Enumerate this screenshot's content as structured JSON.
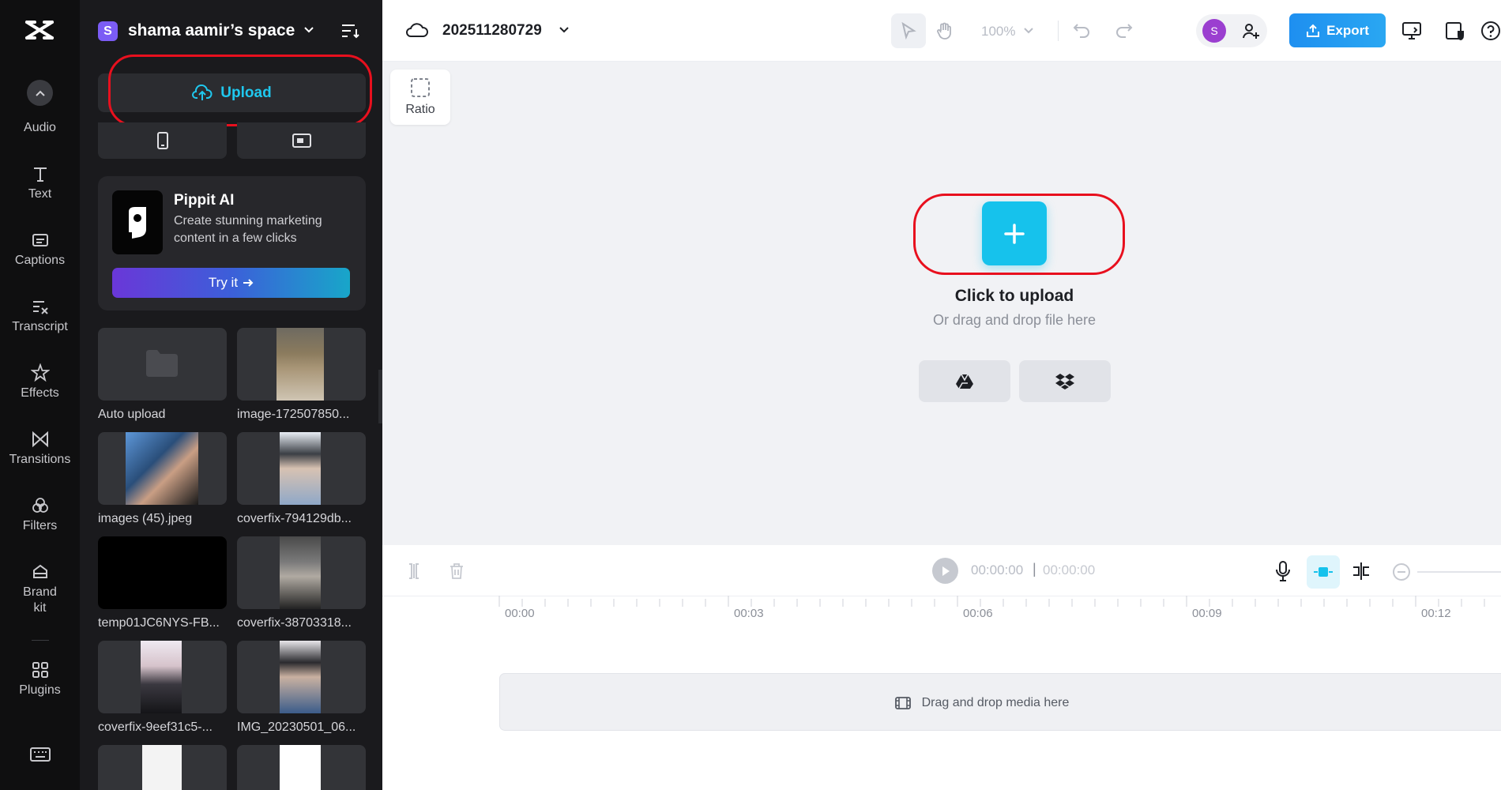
{
  "workspace": {
    "badge": "S",
    "name": "shama aamir’s space"
  },
  "rail": {
    "items": [
      {
        "label": "Audio"
      },
      {
        "label": "Text"
      },
      {
        "label": "Captions"
      },
      {
        "label": "Transcript"
      },
      {
        "label": "Effects"
      },
      {
        "label": "Transitions"
      },
      {
        "label": "Filters"
      },
      {
        "label": "Brand\nkit"
      },
      {
        "label": "Plugins"
      }
    ]
  },
  "panel": {
    "upload_label": "Upload",
    "promo": {
      "title": "Pippit AI",
      "description": "Create stunning marketing content in a few clicks",
      "cta": "Try it"
    },
    "media": [
      {
        "name": "Auto upload"
      },
      {
        "name": "image-172507850..."
      },
      {
        "name": "images (45).jpeg"
      },
      {
        "name": "coverfix-794129db..."
      },
      {
        "name": "temp01JC6NYS-FB..."
      },
      {
        "name": "coverfix-38703318..."
      },
      {
        "name": "coverfix-9eef31c5-..."
      },
      {
        "name": "IMG_20230501_06..."
      }
    ]
  },
  "topbar": {
    "project_title": "202511280729",
    "zoom": "100%",
    "avatar": "S",
    "export_label": "Export"
  },
  "canvas": {
    "ratio_label": "Ratio",
    "upload_title": "Click to upload",
    "upload_subtitle": "Or drag and drop file here"
  },
  "timeline": {
    "current_time": "00:00:00",
    "separator": "|",
    "total_time": "00:00:00",
    "ticks": [
      "00:00",
      "00:03",
      "00:06",
      "00:09",
      "00:12"
    ],
    "drop_hint": "Drag and drop media here"
  },
  "colors": {
    "accent": "#16c2ec",
    "export": "#2196f3",
    "highlight_ring": "#e8101e",
    "rail_bg": "#0f0f10",
    "panel_bg": "#1a1a1d",
    "canvas_bg": "#f1f2f5"
  }
}
